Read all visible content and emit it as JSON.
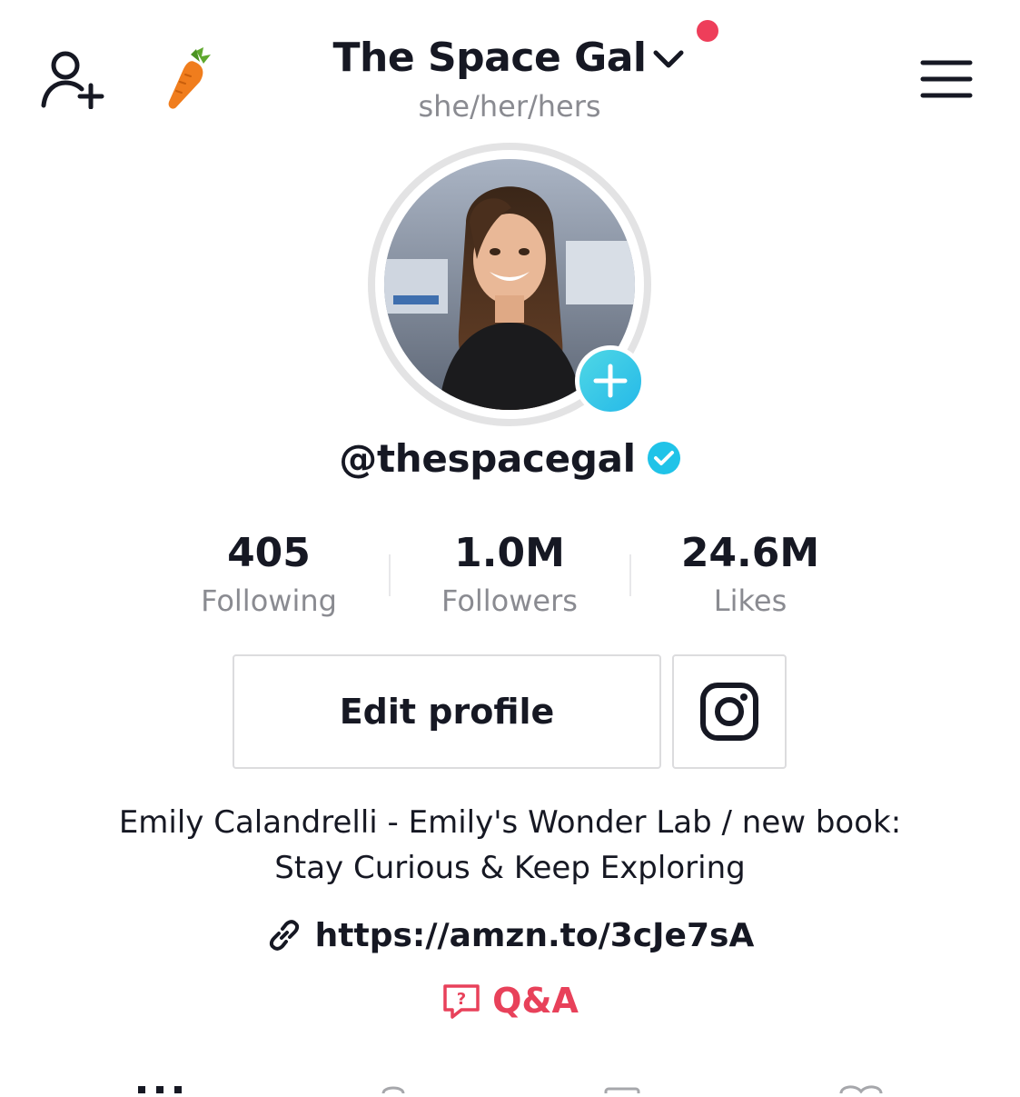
{
  "header": {
    "title": "The Space Gal",
    "pronouns": "she/her/hers",
    "notification_dot_color": "#ee3e5a",
    "icons": [
      "add-friend-icon",
      "carrot-icon",
      "chevron-down-icon",
      "menu-icon"
    ]
  },
  "profile": {
    "username": "@thespacegal",
    "verified": true,
    "verified_color": "#20c3e8",
    "add_badge_color": "#25b9e8"
  },
  "stats": [
    {
      "value": "405",
      "label": "Following"
    },
    {
      "value": "1.0M",
      "label": "Followers"
    },
    {
      "value": "24.6M",
      "label": "Likes"
    }
  ],
  "actions": {
    "edit_profile_label": "Edit profile",
    "instagram_icon": "instagram-icon"
  },
  "bio": {
    "line1": "Emily Calandrelli - Emily's Wonder Lab / new book:",
    "line2": "Stay Curious & Keep Exploring",
    "link": "https://amzn.to/3cJe7sA",
    "qa_label": "Q&A",
    "qa_color": "#e8415a"
  },
  "tabs": [
    "videos-grid-icon",
    "private-lock-icon",
    "reposts-icon",
    "liked-heart-icon"
  ]
}
